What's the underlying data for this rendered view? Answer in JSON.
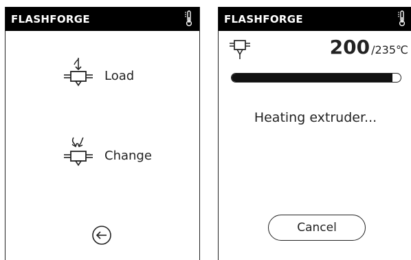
{
  "left_screen": {
    "header": {
      "brand": "FLASHFORGE",
      "status_icon": "thermometer-icon"
    },
    "menu": [
      {
        "label": "Load",
        "icon": "filament-load-icon"
      },
      {
        "label": "Change",
        "icon": "filament-change-icon"
      }
    ],
    "back_icon": "back-arrow-icon"
  },
  "right_screen": {
    "header": {
      "brand": "FLASHFORGE",
      "status_icon": "thermometer-icon"
    },
    "extruder_icon": "extruder-icon",
    "temperature": {
      "current": "200",
      "target": "/235℃"
    },
    "progress": {
      "fraction": 0.95
    },
    "status_text": "Heating extruder...",
    "cancel_label": "Cancel"
  },
  "colors": {
    "header_bg": "#000000",
    "text": "#222222",
    "background": "#ffffff"
  }
}
